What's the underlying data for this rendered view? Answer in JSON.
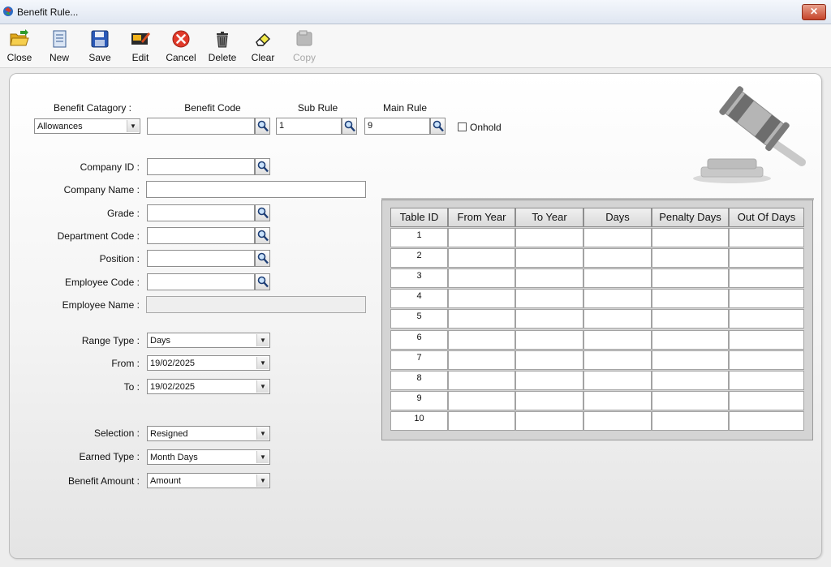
{
  "window": {
    "title": "Benefit Rule...",
    "close_glyph": "✕"
  },
  "toolbar": {
    "close": "Close",
    "new": "New",
    "save": "Save",
    "edit": "Edit",
    "cancel": "Cancel",
    "delete": "Delete",
    "clear": "Clear",
    "copy": "Copy"
  },
  "form": {
    "benefit_category": {
      "label": "Benefit Catagory :",
      "value": "Allowances"
    },
    "benefit_code": {
      "label": "Benefit Code",
      "value": ""
    },
    "sub_rule": {
      "label": "Sub Rule",
      "value": "1"
    },
    "main_rule": {
      "label": "Main Rule",
      "value": "9"
    },
    "onhold": {
      "label": "Onhold",
      "checked": false
    },
    "company_id": {
      "label": "Company ID :",
      "value": ""
    },
    "company_name": {
      "label": "Company Name :",
      "value": ""
    },
    "grade": {
      "label": "Grade :",
      "value": ""
    },
    "department_code": {
      "label": "Department Code :",
      "value": ""
    },
    "position": {
      "label": "Position :",
      "value": ""
    },
    "employee_code": {
      "label": "Employee Code :",
      "value": ""
    },
    "employee_name": {
      "label": "Employee Name :",
      "value": ""
    },
    "range_type": {
      "label": "Range Type :",
      "value": "Days"
    },
    "from": {
      "label": "From :",
      "value": "19/02/2025"
    },
    "to": {
      "label": "To :",
      "value": "19/02/2025"
    },
    "selection": {
      "label": "Selection :",
      "value": "Resigned"
    },
    "earned_type": {
      "label": "Earned Type :",
      "value": "Month Days"
    },
    "benefit_amount": {
      "label": "Benefit Amount :",
      "value": "Amount"
    }
  },
  "grid": {
    "columns": [
      "Table ID",
      "From Year",
      "To Year",
      "Days",
      "Penalty Days",
      "Out Of Days"
    ],
    "rows": [
      {
        "table_id": "1",
        "from_year": "",
        "to_year": "",
        "days": "",
        "penalty_days": "",
        "out_of_days": ""
      },
      {
        "table_id": "2",
        "from_year": "",
        "to_year": "",
        "days": "",
        "penalty_days": "",
        "out_of_days": ""
      },
      {
        "table_id": "3",
        "from_year": "",
        "to_year": "",
        "days": "",
        "penalty_days": "",
        "out_of_days": ""
      },
      {
        "table_id": "4",
        "from_year": "",
        "to_year": "",
        "days": "",
        "penalty_days": "",
        "out_of_days": ""
      },
      {
        "table_id": "5",
        "from_year": "",
        "to_year": "",
        "days": "",
        "penalty_days": "",
        "out_of_days": ""
      },
      {
        "table_id": "6",
        "from_year": "",
        "to_year": "",
        "days": "",
        "penalty_days": "",
        "out_of_days": ""
      },
      {
        "table_id": "7",
        "from_year": "",
        "to_year": "",
        "days": "",
        "penalty_days": "",
        "out_of_days": ""
      },
      {
        "table_id": "8",
        "from_year": "",
        "to_year": "",
        "days": "",
        "penalty_days": "",
        "out_of_days": ""
      },
      {
        "table_id": "9",
        "from_year": "",
        "to_year": "",
        "days": "",
        "penalty_days": "",
        "out_of_days": ""
      },
      {
        "table_id": "10",
        "from_year": "",
        "to_year": "",
        "days": "",
        "penalty_days": "",
        "out_of_days": ""
      }
    ]
  },
  "icons": {
    "lookup": "magnifier-icon",
    "gavel": "gavel-icon",
    "dropdown": "chevron-down-icon"
  },
  "colors": {
    "titlebar": "#dfe6f1",
    "close_button": "#c5442a",
    "panel": "#f3f3f3"
  }
}
